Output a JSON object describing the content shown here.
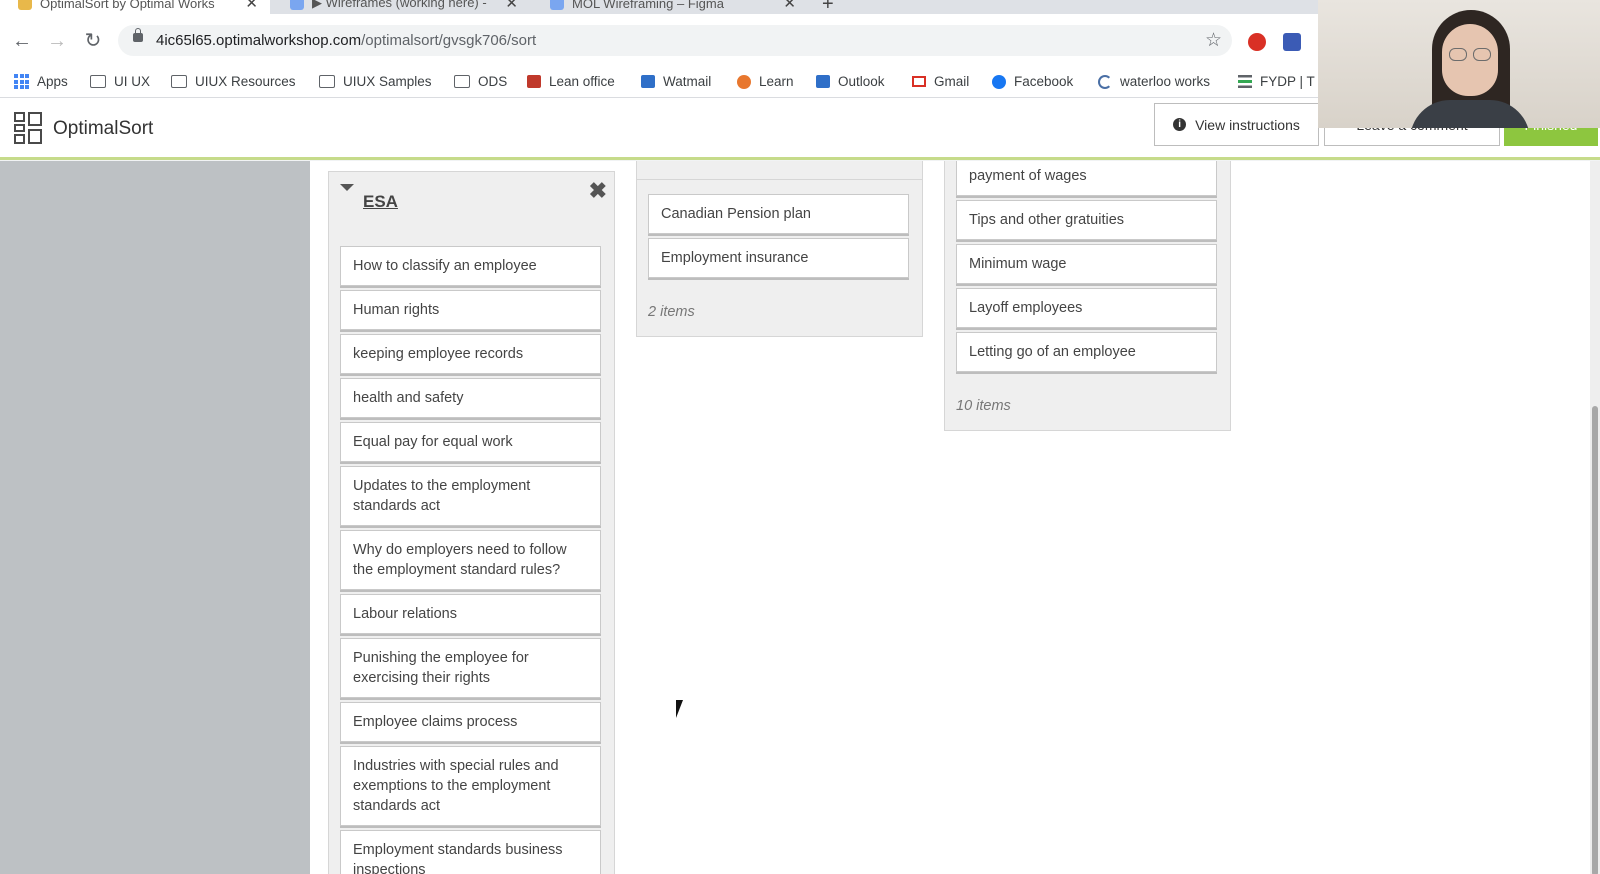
{
  "browser": {
    "tabs": [
      {
        "title": "OptimalSort by Optimal Works",
        "active": true
      },
      {
        "title": "▶ Wireframes (working here) -",
        "active": false
      },
      {
        "title": "MOL Wireframing – Figma",
        "active": false
      }
    ],
    "url_host": "4ic65l65.optimalworkshop.com",
    "url_path": "/optimalsort/gvsgk706/sort",
    "bookmarks": [
      "Apps",
      "UI UX",
      "UIUX Resources",
      "UIUX Samples",
      "ODS",
      "Lean office",
      "Watmail",
      "Learn",
      "Outlook",
      "Gmail",
      "Facebook",
      "waterloo works",
      "FYDP | T"
    ]
  },
  "app": {
    "brand": "OptimalSort",
    "view_instructions": "View instructions",
    "leave_comment": "Leave a comment",
    "finished": "Finished"
  },
  "groups": {
    "esa": {
      "name": "ESA",
      "cards": [
        "How to classify an employee",
        "Human rights",
        "keeping employee records",
        "health and safety",
        "Equal pay for equal work",
        "Updates to the employment standards act",
        "Why do employers need to follow the employment standard rules?",
        "Labour relations",
        "Punishing the employee for exercising their rights",
        "Employee claims process",
        "Industries with special rules and exemptions to the employment standards act",
        "Employment standards business inspections"
      ]
    },
    "middle": {
      "cards": [
        "Canadian Pension plan",
        "Employment insurance"
      ],
      "count": "2 items"
    },
    "right": {
      "cards": [
        "payment of wages",
        "Tips and other gratuities",
        "Minimum wage",
        "Layoff employees",
        "Letting go of an employee"
      ],
      "count": "10 items"
    }
  },
  "colors": {
    "accent_green": "#8dc63f",
    "header_border": "#c6db8a",
    "sidebar": "#bdc1c4"
  }
}
